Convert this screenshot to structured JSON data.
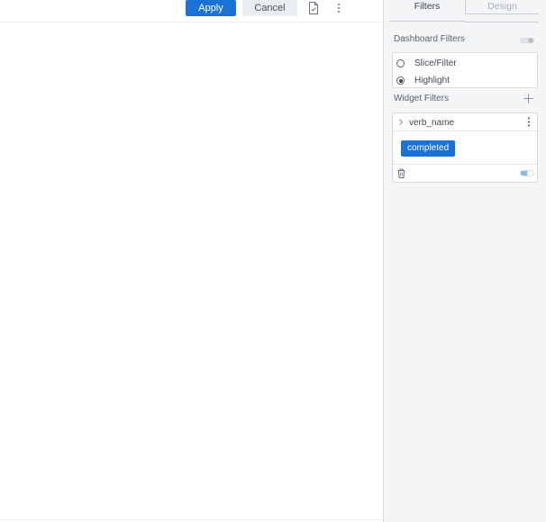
{
  "toolbar": {
    "apply_label": "Apply",
    "cancel_label": "Cancel",
    "icons": [
      "document-check-icon",
      "more-vertical-icon"
    ]
  },
  "panel": {
    "tabs": [
      {
        "label": "Filters",
        "active": true
      },
      {
        "label": "Design",
        "active": false
      }
    ],
    "dashboard_filters": {
      "title": "Dashboard Filters",
      "enabled": false,
      "options": [
        {
          "label": "Slice/Filter",
          "selected": false
        },
        {
          "label": "Highlight",
          "selected": true
        }
      ]
    },
    "widget_filters": {
      "title": "Widget Filters",
      "filters": [
        {
          "field": "verb_name",
          "values": [
            "completed"
          ],
          "enabled": true
        }
      ]
    }
  },
  "colors": {
    "accent": "#1b72d6",
    "panel_bg": "#f4f5f6",
    "border": "#d9dce0"
  }
}
